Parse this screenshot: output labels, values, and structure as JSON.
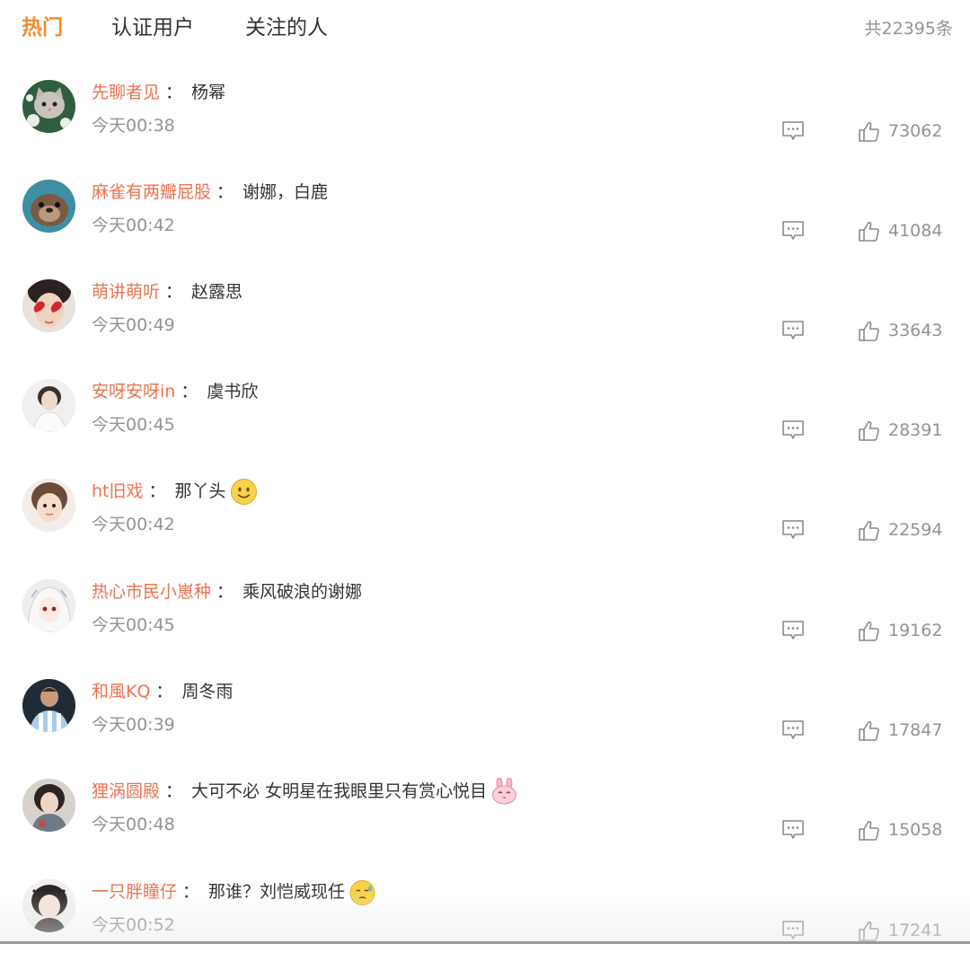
{
  "tabs": [
    {
      "label": "热门",
      "active": true
    },
    {
      "label": "认证用户",
      "active": false
    },
    {
      "label": "关注的人",
      "active": false
    }
  ],
  "total": "共22395条",
  "colors": {
    "accent": "#f28c2c",
    "username": "#eb7350",
    "muted": "#939393",
    "text": "#333333"
  },
  "comments": [
    {
      "user": "先聊者见",
      "colon": "：",
      "text": "杨幂",
      "emoji": "",
      "time": "今天00:38",
      "likes": "73062",
      "avatar_icon": "cat-avatar"
    },
    {
      "user": "麻雀有两瓣屁股",
      "colon": "：",
      "text": "谢娜，白鹿",
      "emoji": "",
      "time": "今天00:42",
      "likes": "41084",
      "avatar_icon": "otter-avatar"
    },
    {
      "user": "萌讲萌听",
      "colon": "：",
      "text": "赵露思",
      "emoji": "",
      "time": "今天00:49",
      "likes": "33643",
      "avatar_icon": "heart-glasses-avatar"
    },
    {
      "user": "安呀安呀in",
      "colon": "：",
      "text": "虞书欣",
      "emoji": "",
      "time": "今天00:45",
      "likes": "28391",
      "avatar_icon": "girl-avatar"
    },
    {
      "user": "ht旧戏",
      "colon": "：",
      "text": "那丫头",
      "emoji": "smile-emoji",
      "time": "今天00:42",
      "likes": "22594",
      "avatar_icon": "child-avatar"
    },
    {
      "user": "热心市民小崽种",
      "colon": "：",
      "text": "乘风破浪的谢娜",
      "emoji": "",
      "time": "今天00:45",
      "likes": "19162",
      "avatar_icon": "anime-avatar"
    },
    {
      "user": "和風KQ",
      "colon": "：",
      "text": "周冬雨",
      "emoji": "",
      "time": "今天00:39",
      "likes": "17847",
      "avatar_icon": "footballer-avatar"
    },
    {
      "user": "狸涡圆殿",
      "colon": "：",
      "text": "大可不必 女明星在我眼里只有赏心悦目",
      "emoji": "bunny-emoji",
      "time": "今天00:48",
      "likes": "15058",
      "avatar_icon": "portrait-avatar"
    },
    {
      "user": "一只胖瞳仔",
      "colon": "：",
      "text": "那谁？刘恺威现任",
      "emoji": "sweat-emoji",
      "time": "今天00:52",
      "likes": "17241",
      "avatar_icon": "doll-avatar"
    }
  ]
}
